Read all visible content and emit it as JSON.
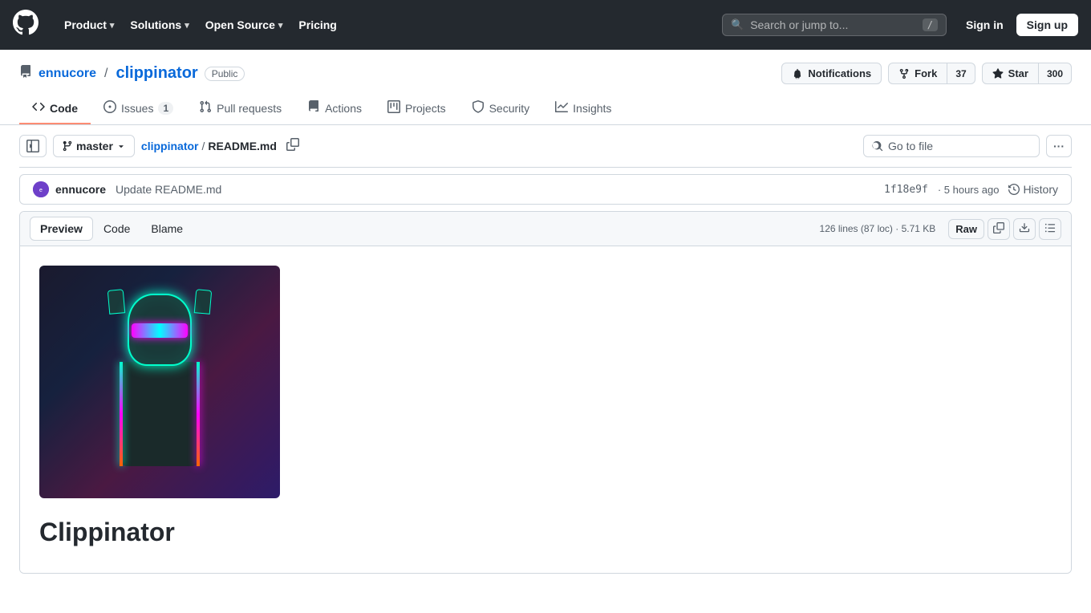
{
  "nav": {
    "logo": "⬡",
    "items": [
      {
        "label": "Product",
        "hasDropdown": true
      },
      {
        "label": "Solutions",
        "hasDropdown": true
      },
      {
        "label": "Open Source",
        "hasDropdown": true
      },
      {
        "label": "Pricing",
        "hasDropdown": false
      }
    ],
    "search_placeholder": "Search or jump to...",
    "search_kbd": "/",
    "sign_in": "Sign in",
    "sign_up": "Sign up"
  },
  "repo": {
    "owner": "ennucore",
    "name": "clippinator",
    "visibility": "Public",
    "notifications_label": "Notifications",
    "fork_label": "Fork",
    "fork_count": "37",
    "star_label": "Star",
    "star_count": "300"
  },
  "tabs": [
    {
      "id": "code",
      "label": "Code",
      "icon": "<>",
      "active": true
    },
    {
      "id": "issues",
      "label": "Issues",
      "icon": "○",
      "badge": "1",
      "active": false
    },
    {
      "id": "pull-requests",
      "label": "Pull requests",
      "icon": "↔",
      "active": false
    },
    {
      "id": "actions",
      "label": "Actions",
      "icon": "▷",
      "active": false
    },
    {
      "id": "projects",
      "label": "Projects",
      "icon": "⊞",
      "active": false
    },
    {
      "id": "security",
      "label": "Security",
      "icon": "◻",
      "active": false
    },
    {
      "id": "insights",
      "label": "Insights",
      "icon": "↗",
      "active": false
    }
  ],
  "file_browser": {
    "branch": "master",
    "breadcrumb_repo": "clippinator",
    "breadcrumb_sep": "/",
    "breadcrumb_file": "README.md",
    "goto_file_placeholder": "Go to file",
    "more_label": "···"
  },
  "commit": {
    "author": "ennucore",
    "message": "Update README.md",
    "hash": "1f18e9f",
    "time": "· 5 hours ago",
    "history_label": "History"
  },
  "viewer": {
    "tabs": [
      "Preview",
      "Code",
      "Blame"
    ],
    "active_tab": "Preview",
    "meta": "126 lines (87 loc) · 5.71 KB",
    "actions": {
      "raw": "Raw",
      "copy_icon": "⎘",
      "download_icon": "⬇",
      "list_icon": "≡"
    }
  },
  "readme": {
    "title": "Clippinator"
  }
}
